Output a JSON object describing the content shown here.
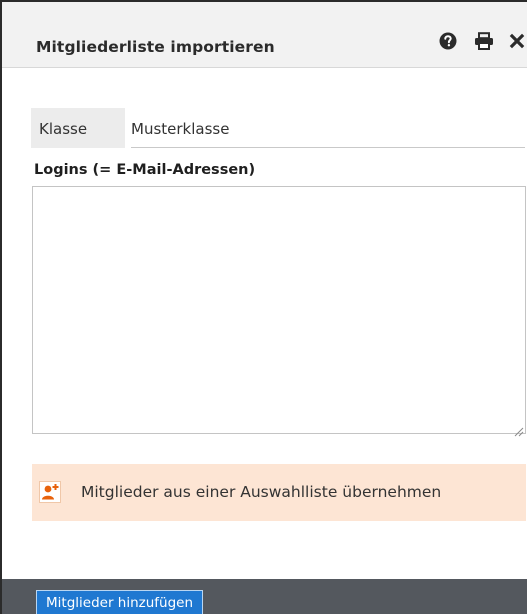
{
  "dialog": {
    "title": "Mitgliederliste importieren",
    "icons": {
      "help": "help-circle-icon",
      "print": "printer-icon",
      "close": "close-icon"
    }
  },
  "form": {
    "klasse_label": "Klasse",
    "klasse_value": "Musterklasse",
    "logins_label": "Logins (= E-Mail-Adressen)",
    "logins_value": "",
    "picklist_label": "Mitglieder aus einer Auswahlliste übernehmen",
    "picklist_icon": "add-user-icon"
  },
  "footer": {
    "submit_label": "Mitglieder hinzufügen"
  },
  "colors": {
    "accent": "#1f78d1",
    "picklist_bg": "#fde5d4",
    "add_user_icon": "#e8620c",
    "footer_bg": "#54585e"
  }
}
